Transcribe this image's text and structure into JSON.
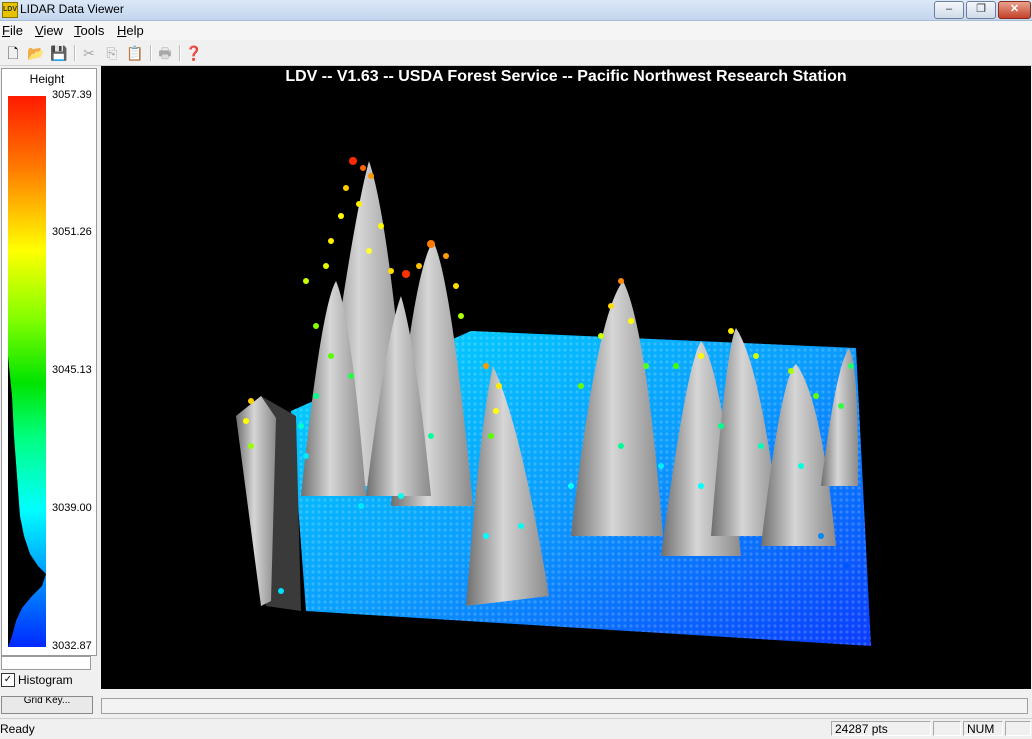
{
  "window": {
    "title": "LIDAR Data Viewer",
    "icon_name": "ldv-app-icon",
    "icon_text": "LDV"
  },
  "window_controls": {
    "minimize": "–",
    "maximize": "❐",
    "close": "✕"
  },
  "menu": [
    {
      "label": "File",
      "accel": "F",
      "rest": "ile"
    },
    {
      "label": "View",
      "accel": "V",
      "rest": "iew"
    },
    {
      "label": "Tools",
      "accel": "T",
      "rest": "ools"
    },
    {
      "label": "Help",
      "accel": "H",
      "rest": "elp"
    }
  ],
  "toolbar": {
    "new_icon": "🗋",
    "open_icon": "📂",
    "save_icon": "💾",
    "cut_icon": "✂",
    "copy_icon": "⎘",
    "paste_icon": "📋",
    "print_icon": "🖶",
    "help_icon": "❓"
  },
  "legend": {
    "title": "Height",
    "ticks": [
      "3057.39",
      "3051.26",
      "3045.13",
      "3039.00",
      "3032.87"
    ],
    "histogram_label": "Histogram",
    "histogram_checked": "✓",
    "button_label": "Grid Key..."
  },
  "viewport": {
    "title": "LDV -- V1.63 -- USDA Forest Service -- Pacific Northwest Research Station",
    "background": "#000000"
  },
  "status": {
    "text": "Ready",
    "points": "24287 pts",
    "pane2": "",
    "num": "NUM",
    "pane4": ""
  }
}
